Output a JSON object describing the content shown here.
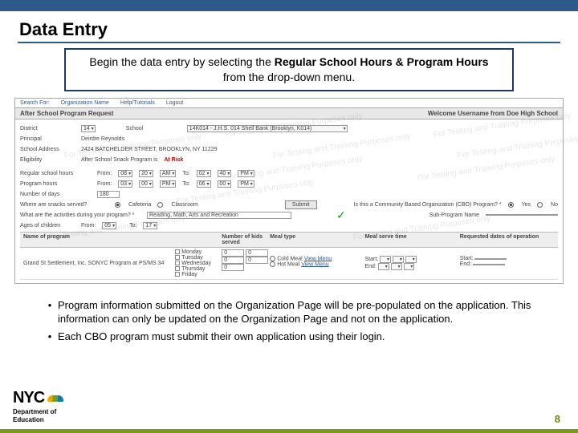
{
  "slide": {
    "title": "Data Entry",
    "callout_pre": "Begin the data entry by selecting the ",
    "callout_bold1": "Regular School Hours & Program Hours",
    "callout_post": " from the drop-down menu."
  },
  "app": {
    "nav": {
      "search": "Search For:",
      "org": "Organization Name",
      "help": "Help/Tutorials",
      "logout": "Logout"
    },
    "header_left": "After School Program Request",
    "header_right": "Welcome Username from Doe High School",
    "watermark": "For Testing and Training Purposes only",
    "fields": {
      "district_lbl": "District",
      "district_val": "14",
      "school_lbl": "School",
      "school_val": "14K014 - J.H.S. 014 Shell Bank (Brooklyn, K014)",
      "principal_lbl": "Principal",
      "principal_val": "Deirdre Reynolds",
      "addr_lbl": "School Address",
      "addr_val": "2424 BATCHELDER STREET, BROOKLYN, NY 11229",
      "elig_lbl": "Eligibility",
      "elig_val": "After School Snack Program is ",
      "elig_risk": "At Risk",
      "rsh_lbl": "Regular school hours",
      "from_lbl": "From:",
      "to_lbl": "To:",
      "hh1": "08",
      "mm1": "20",
      "ap1": "AM",
      "hh2": "02",
      "mm2": "40",
      "ap2": "PM",
      "ph_lbl": "Program hours",
      "hh3": "03",
      "mm3": "00",
      "ap3": "PM",
      "hh4": "06",
      "mm4": "00",
      "ap4": "PM",
      "days_lbl": "Number of days",
      "days_val": "180",
      "where_lbl": "Where are snacks served?",
      "opt_cafe": "Cafeteria",
      "opt_class": "Classroom",
      "submit": "Submit",
      "cbop_lbl": "Is this a Community Based Organization (CBO) Program? *",
      "yes": "Yes",
      "no": "No",
      "act_lbl": "What are the activities during your program? *",
      "act_val": "Reading, Math, Arts and Recreation",
      "subprog_lbl": "Sub-Program Name",
      "ages_lbl": "Ages of children",
      "ages_from": "05",
      "ages_to": "17",
      "to_sep": "To:"
    },
    "table": {
      "h_name": "Name of program",
      "h_days": "",
      "h_kids": "Number of kids served",
      "h_meal": "Meal type",
      "h_time": "Meal serve time",
      "h_dates": "Requested dates of operation",
      "prog_name": "Grand St Settlement, Inc. SONYC Program at PS/MS 34",
      "days": {
        "mon": "Monday",
        "tue": "Tuesday",
        "wed": "Wednesday",
        "thu": "Thursday",
        "fri": "Friday"
      },
      "zeros": "0",
      "meal1": "Cold Meal",
      "meal2": "Hot Meal",
      "viewmenu": "View Menu",
      "start_lbl": "Start:",
      "end_lbl": "End:"
    }
  },
  "bullets": {
    "b1": "Program information submitted on the Organization Page will be pre-populated on the application.  This information can only be updated on the Organization Page and not on the application.",
    "b2": "Each CBO program must submit their own application using their login."
  },
  "footer": {
    "brand": "NYC",
    "dept1": "Department of",
    "dept2": "Education",
    "page": "8"
  }
}
